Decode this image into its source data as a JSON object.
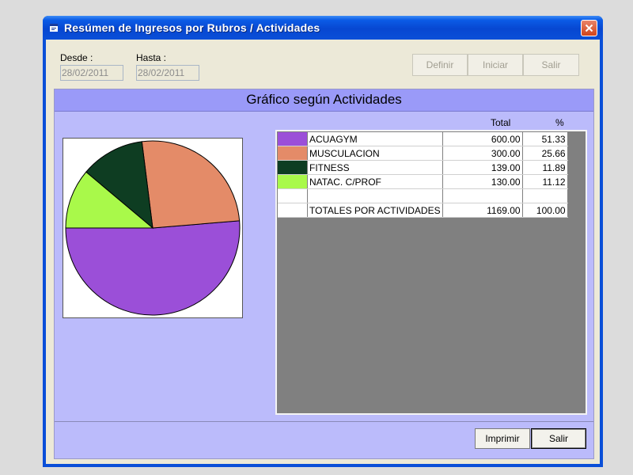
{
  "window": {
    "title": "Resúmen de Ingresos por Rubros / Actividades"
  },
  "filters": {
    "desde_label": "Desde :",
    "desde_value": "28/02/2011",
    "hasta_label": "Hasta :",
    "hasta_value": "28/02/2011"
  },
  "toolbar": {
    "definir": "Definir",
    "iniciar": "Iniciar",
    "salir": "Salir"
  },
  "panel": {
    "title": "Gráfico según Actividades"
  },
  "table": {
    "columns": [
      "Total",
      "%"
    ],
    "rows": [
      {
        "name": "ACUAGYM",
        "total": "600.00",
        "pct": "51.33",
        "color": "#9b4fd8"
      },
      {
        "name": "MUSCULACION",
        "total": "300.00",
        "pct": "25.66",
        "color": "#e48b68"
      },
      {
        "name": "FITNESS",
        "total": "139.00",
        "pct": "11.89",
        "color": "#0e3d22"
      },
      {
        "name": "NATAC. C/PROF",
        "total": "130.00",
        "pct": "11.12",
        "color": "#a9f94a"
      }
    ],
    "totals": {
      "name": "TOTALES POR ACTIVIDADES",
      "total": "1169.00",
      "pct": "100.00"
    }
  },
  "chart_data": {
    "type": "pie",
    "categories": [
      "ACUAGYM",
      "MUSCULACION",
      "FITNESS",
      "NATAC. C/PROF"
    ],
    "values": [
      600,
      300,
      139,
      130
    ],
    "colors": [
      "#9b4fd8",
      "#e48b68",
      "#0e3d22",
      "#a9f94a"
    ]
  },
  "footer": {
    "imprimir": "Imprimir",
    "salir": "Salir"
  }
}
